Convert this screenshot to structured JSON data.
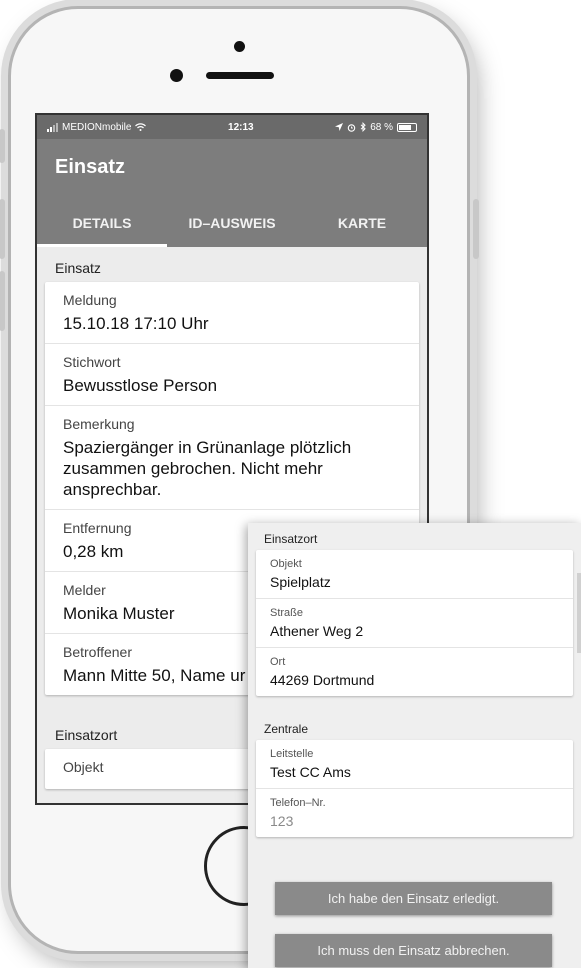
{
  "status_bar": {
    "carrier": "MEDIONmobile",
    "time": "12:13",
    "battery": "68 %",
    "icons": [
      "signal-icon",
      "wifi-icon",
      "location-icon",
      "alarm-icon",
      "bluetooth-icon",
      "battery-icon"
    ]
  },
  "app": {
    "title": "Einsatz",
    "tabs": [
      {
        "label": "DETAILS",
        "active": true
      },
      {
        "label": "ID–AUSWEIS",
        "active": false
      },
      {
        "label": "KARTE",
        "active": false
      }
    ]
  },
  "details": {
    "section_title": "Einsatz",
    "fields": [
      {
        "label": "Meldung",
        "value": "15.10.18 17:10 Uhr"
      },
      {
        "label": "Stichwort",
        "value": "Bewusstlose Person"
      },
      {
        "label": "Bemerkung",
        "value": "Spaziergänger in Grünanlage plötzlich zusammen gebrochen. Nicht mehr ansprechbar."
      },
      {
        "label": "Entfernung",
        "value": "0,28 km"
      },
      {
        "label": "Melder",
        "value": "Monika Muster"
      },
      {
        "label": "Betroffener",
        "value": "Mann Mitte 50, Name ur"
      }
    ],
    "next_section_title": "Einsatzort",
    "next_field_label": "Objekt"
  },
  "overlay": {
    "einsatzort": {
      "title": "Einsatzort",
      "fields": [
        {
          "label": "Objekt",
          "value": "Spielplatz"
        },
        {
          "label": "Straße",
          "value": "Athener Weg 2"
        },
        {
          "label": "Ort",
          "value": "44269 Dortmund"
        }
      ]
    },
    "zentrale": {
      "title": "Zentrale",
      "fields": [
        {
          "label": "Leitstelle",
          "value": "Test CC Ams"
        },
        {
          "label": "Telefon–Nr.",
          "value": "123"
        }
      ]
    },
    "buttons": {
      "done": "Ich habe den Einsatz erledigt.",
      "abort": "Ich muss den Einsatz abbrechen."
    }
  },
  "colors": {
    "app_bar": "#7d7d7d",
    "status_bar": "#6a6a6a",
    "button": "#8a8a8a",
    "background": "#ececec"
  }
}
